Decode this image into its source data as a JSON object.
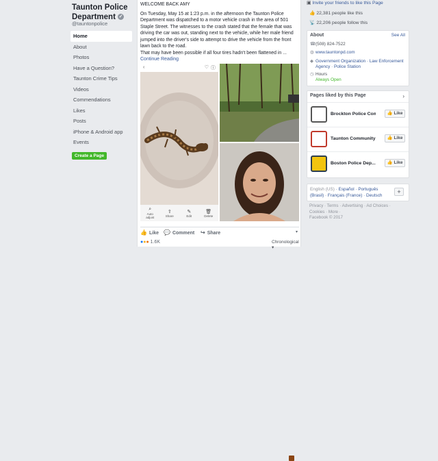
{
  "sidebar": {
    "page_name": "Taunton Police Department",
    "handle": "@tauntonpolice",
    "items": [
      "Home",
      "About",
      "Photos",
      "Have a Question?",
      "Taunton Crime Tips",
      "Videos",
      "Commendations",
      "Likes",
      "Posts",
      "iPhone & Android app",
      "Events"
    ],
    "create_page": "Create a Page"
  },
  "post": {
    "line1": "WELCOME BACK AMY",
    "body": "On Tuesday, May 15 at 1:23 p.m. in the afternoon the Taunton Police Department was dispatched to a motor vehicle crash in the area of 501 Staple Street. The witnesses to the crash stated that the female that was driving the car was out, standing next to the vehicle, while her male friend jumped into the driver's side to attempt to drive the vehicle from the front lawn back to the road.",
    "body2": "That may have been possible if all four tires hadn't been flattened in ...",
    "continue": "Continue Reading",
    "photo_tools": [
      "Auto adjust",
      "Share",
      "Edit",
      "Delete"
    ],
    "actions": {
      "like": "Like",
      "comment": "Comment",
      "share": "Share"
    },
    "reactions_count": "1.6K",
    "sort": "Chronological"
  },
  "right": {
    "invite": "Invite your friends to like this Page",
    "likes": "22,381 people like this",
    "follows": "22,206 people follow this",
    "about": {
      "title": "About",
      "see_all": "See All",
      "phone": "(508) 824-7522",
      "website": "www.tauntonpd.com",
      "category": "Government Organization · Law Enforcement Agency · Police Station",
      "hours": "Hours",
      "status": "Always Open"
    },
    "liked": {
      "title": "Pages liked by this Page",
      "items": [
        {
          "name": "Brockton Police Com...",
          "btn": "Like"
        },
        {
          "name": "Taunton Community ...",
          "btn": "Like"
        },
        {
          "name": "Boston Police Dep...",
          "btn": "Like"
        }
      ]
    },
    "languages": {
      "current": "English (US)",
      "others": "Español · Português (Brasil) · Français (France) · Deutsch"
    },
    "footer": {
      "links": "Privacy · Terms · Advertising · Ad Choices · Cookies · More ·",
      "copyright": "Facebook © 2017"
    }
  }
}
